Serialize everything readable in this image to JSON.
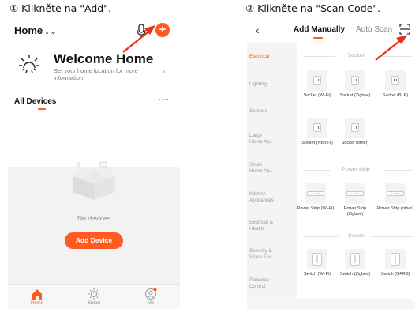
{
  "captions": {
    "step1": "① Klikněte na \"Add\".",
    "step2": "② Klikněte na \"Scan Code\"."
  },
  "left_screen": {
    "home_title": "Home .",
    "home_chevron": "⌄",
    "add_button": "+",
    "welcome_title": "Welcome Home",
    "welcome_sub": "Set your home location for more information",
    "welcome_arrow": "›",
    "all_devices": "All Devices",
    "more": "···",
    "empty_text": "No devices",
    "add_device": "Add Device",
    "tabs": [
      {
        "label": "Home",
        "icon": "home-icon",
        "active": true
      },
      {
        "label": "Smart",
        "icon": "sun-icon",
        "active": false
      },
      {
        "label": "Me",
        "icon": "person-icon",
        "active": false
      }
    ]
  },
  "right_screen": {
    "back": "‹",
    "tab_manual": "Add Manually",
    "tab_auto": "Auto Scan",
    "categories": [
      "Electrical",
      "Lighting",
      "Sensors",
      "Large Home Ap...",
      "Small Home Ap...",
      "Kitchen Appliances",
      "Exercise & Health",
      "Security & Video Sur...",
      "Gateway Control"
    ],
    "sections": {
      "socket": "Socket",
      "power_strip": "Power Strip",
      "switch": "Switch"
    },
    "devices": {
      "socket_wifi": "Socket (Wi-Fi)",
      "socket_zigbee": "Socket (Zigbee)",
      "socket_ble": "Socket (BLE)",
      "socket_nbiot": "Socket (NB-IoT)",
      "socket_other": "Socket (other)",
      "strip_wifi": "Power Strip (Wi-Fi)",
      "strip_zigbee": "Power Strip (Zigbee)",
      "strip_other": "Power Strip (other)",
      "switch_wifi": "Switch (Wi-Fi)",
      "switch_zigbee": "Switch (Zigbee)",
      "switch_gprs": "Switch (GPRS)"
    },
    "strip_glyph": "• ••••"
  },
  "colors": {
    "accent": "#ff5a1f",
    "arrow": "#e8301e"
  }
}
